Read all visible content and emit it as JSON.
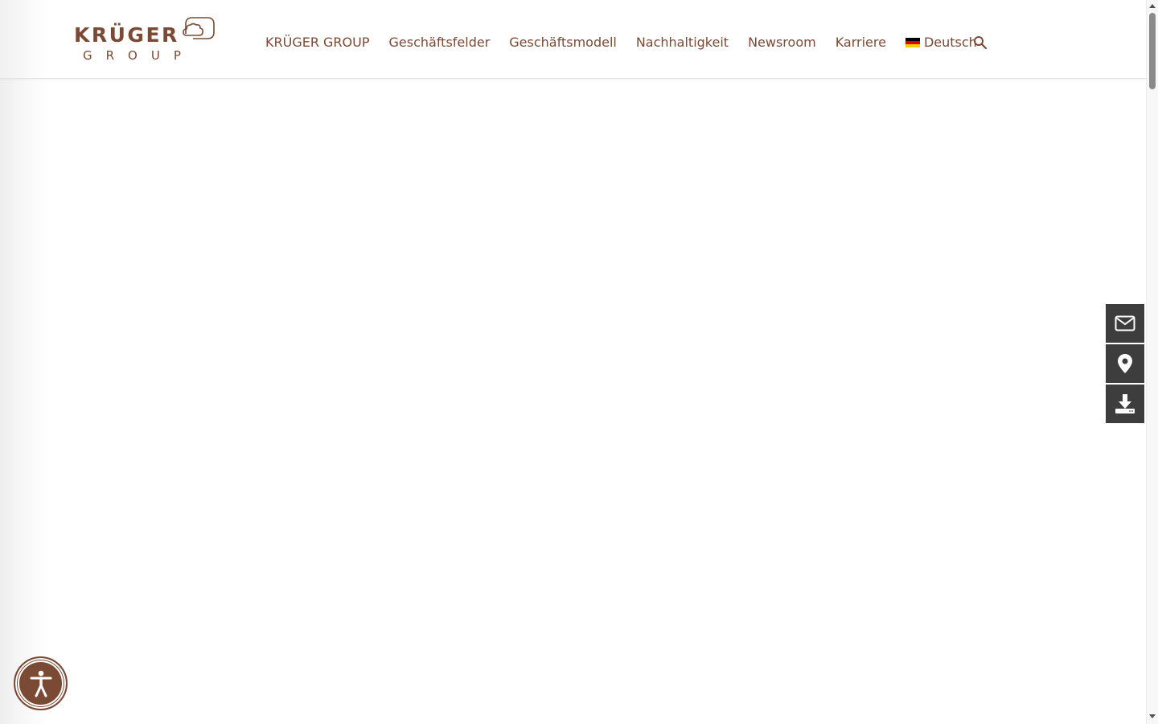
{
  "header": {
    "logo": {
      "wordmark": "KRÜGER",
      "subtitle": "GROUP"
    },
    "nav": [
      {
        "label": "KRÜGER GROUP"
      },
      {
        "label": "Geschäftsfelder"
      },
      {
        "label": "Geschäftsmodell"
      },
      {
        "label": "Nachhaltigkeit"
      },
      {
        "label": "Newsroom"
      },
      {
        "label": "Karriere"
      }
    ],
    "language": {
      "label": "Deutsch",
      "flag_icon": "flag-germany-icon"
    },
    "search_icon": "search-icon"
  },
  "side_actions": [
    {
      "icon": "mail-icon"
    },
    {
      "icon": "location-pin-icon"
    },
    {
      "icon": "download-icon"
    }
  ],
  "accessibility": {
    "icon": "accessibility-person-icon"
  },
  "colors": {
    "brand_brown": "#7a4a35",
    "side_button_bg": "#3d3d3d",
    "background": "#ffffff"
  }
}
